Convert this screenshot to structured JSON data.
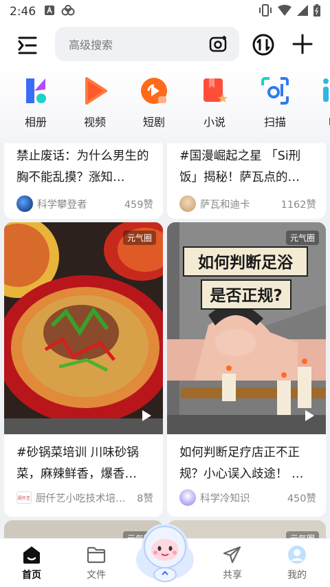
{
  "status_bar": {
    "time": "2:46"
  },
  "header": {
    "search_placeholder": "高级搜索"
  },
  "quick_apps": [
    {
      "label": "相册",
      "icon": "album-icon",
      "color": "#3b6cf6"
    },
    {
      "label": "视频",
      "icon": "video-icon",
      "color": "#ff5a2c"
    },
    {
      "label": "短剧",
      "icon": "short-drama-icon",
      "color": "#ff6a1a"
    },
    {
      "label": "小说",
      "icon": "novel-icon",
      "color": "#ff4d3a"
    },
    {
      "label": "扫描",
      "icon": "scan-icon",
      "color": "#2fb6e8"
    },
    {
      "label": "听",
      "icon": "listen-icon",
      "color": "#2fb6e8"
    }
  ],
  "feed": {
    "cards": [
      {
        "title": "禁止废话：为什么男生的胸不能乱摸？涨知…",
        "author": "科学攀登者",
        "likes": "459赞"
      },
      {
        "title": "#国漫崛起之星 「Si刑饭」揭秘！萨瓦点的…",
        "author": "萨瓦和迪卡",
        "likes": "1162赞"
      },
      {
        "title": "#砂锅菜培训 川味砂锅菜，麻辣鲜香，爆香…",
        "author": "厨仟艺小吃技术培…",
        "likes": "8赞",
        "badge": "元气圈",
        "avatar_text": "厨仟艺"
      },
      {
        "title": "如何判断足疗店正不正规？小心误入歧途！ …",
        "author": "科学冷知识",
        "likes": "450赞",
        "badge": "元气圈",
        "image_text_line1": "如何判断足浴",
        "image_text_line2": "是否正规?"
      },
      {
        "badge": "元气圈"
      },
      {
        "badge": "元气圈"
      }
    ]
  },
  "bottom_nav": [
    {
      "label": "首页",
      "icon": "home-icon",
      "active": true
    },
    {
      "label": "文件",
      "icon": "folder-icon"
    },
    {
      "label": "共享",
      "icon": "share-icon"
    },
    {
      "label": "我的",
      "icon": "profile-icon"
    }
  ],
  "colors": {
    "accent": "#1f6bff",
    "background": "#eff1f5"
  }
}
